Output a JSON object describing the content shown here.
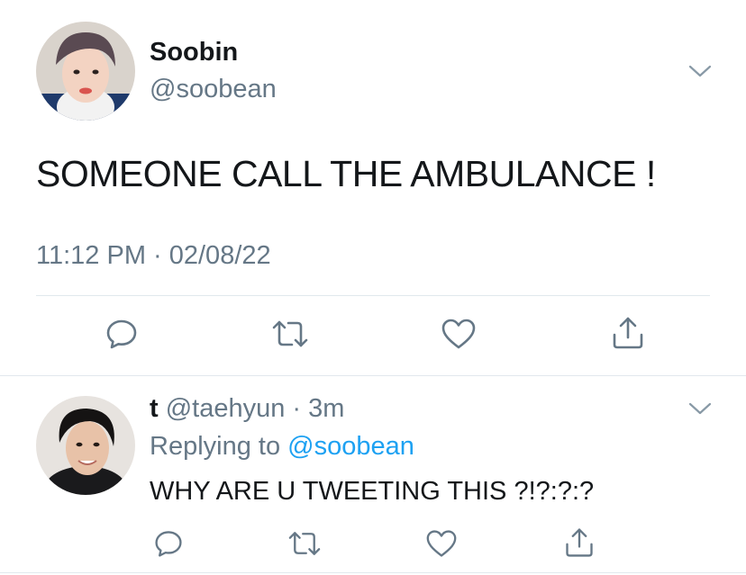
{
  "tweet": {
    "name": "Soobin",
    "handle": "@soobean",
    "text": "SOMEONE CALL THE AMBULANCE !",
    "timestamp": "11:12 PM · 02/08/22"
  },
  "reply": {
    "name": "t",
    "handle": "@taehyun",
    "separator": " · ",
    "time": "3m",
    "replying_prefix": "Replying to ",
    "replying_to": "@soobean",
    "text": "WHY ARE U TWEETING THIS ?!?:?:?"
  },
  "icons": [
    "chevron-down-icon",
    "reply-icon",
    "retweet-icon",
    "like-icon",
    "share-icon"
  ],
  "colors": {
    "text": "#14171a",
    "secondary": "#657786",
    "link": "#1da1f2",
    "divider": "#e1e8ed"
  }
}
